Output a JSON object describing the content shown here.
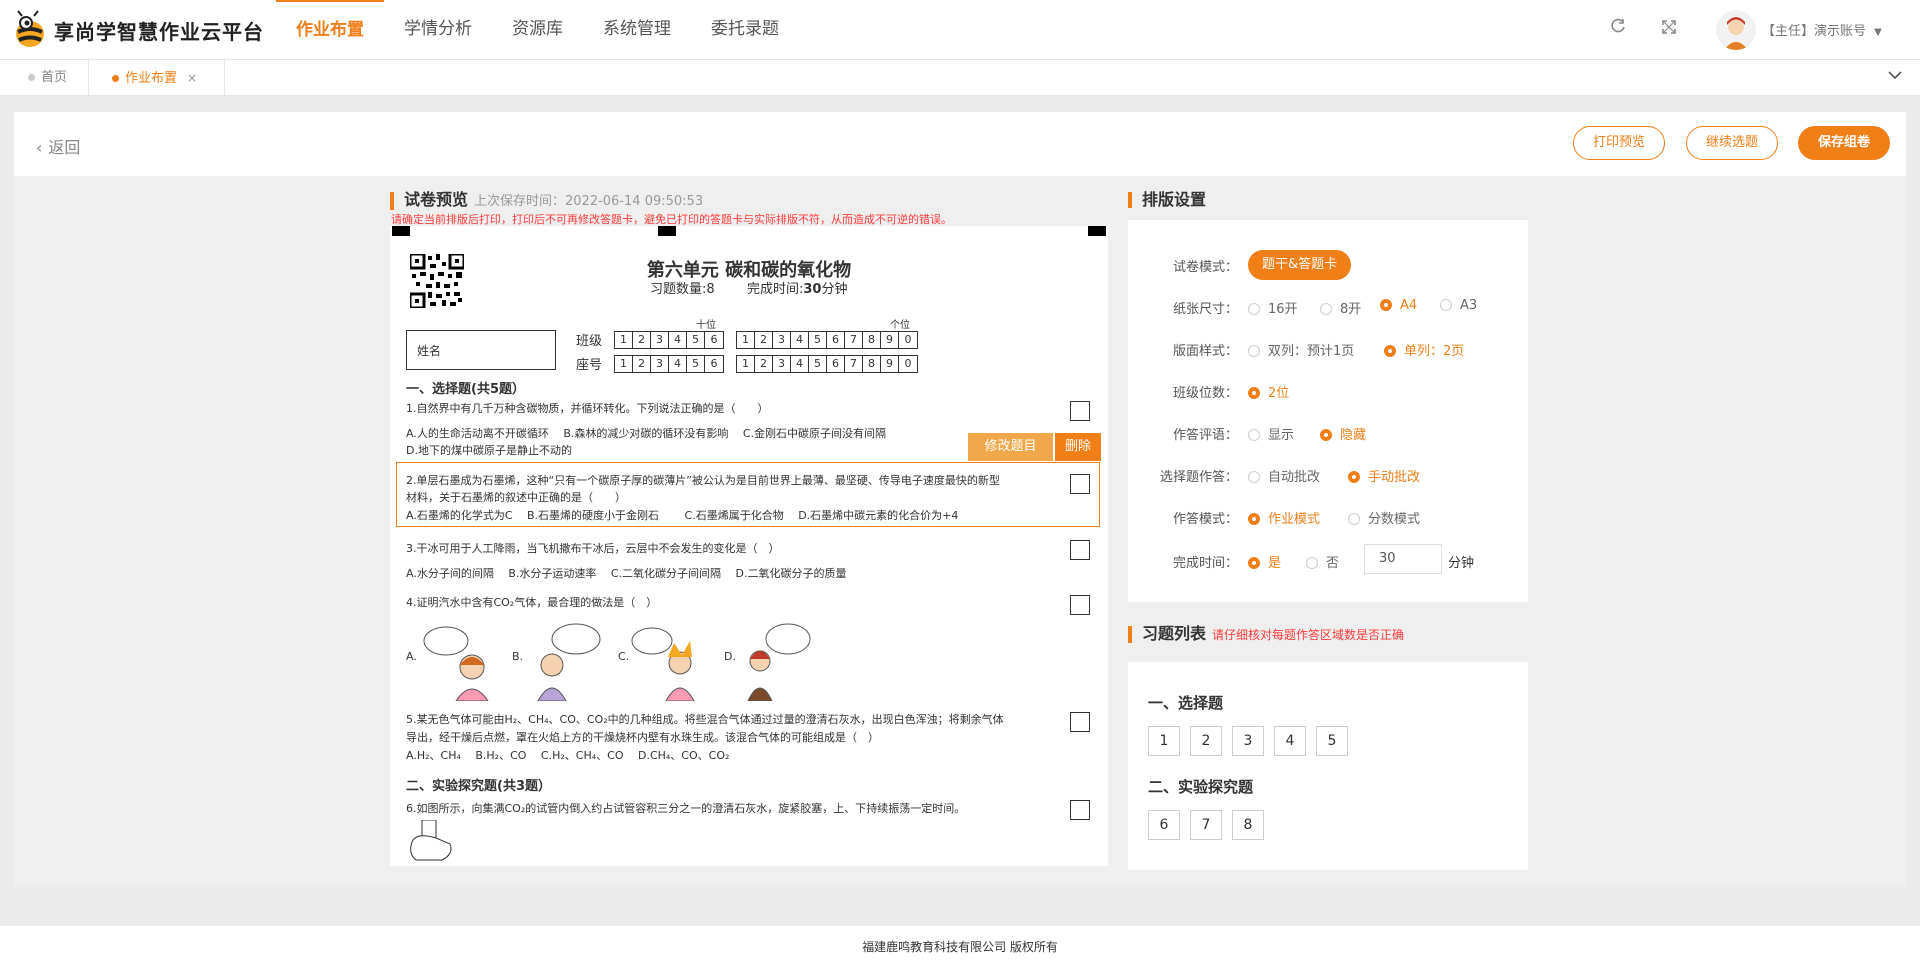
{
  "header": {
    "brand": "享尚学智慧作业云平台",
    "nav": [
      "作业布置",
      "学情分析",
      "资源库",
      "系统管理",
      "委托录题"
    ],
    "active_nav": 0,
    "user_label": "【主任】演示账号"
  },
  "tabs": [
    {
      "label": "首页",
      "active": false
    },
    {
      "label": "作业布置",
      "active": true,
      "close": "×"
    }
  ],
  "toolbar": {
    "back": "返回",
    "print_preview": "打印预览",
    "continue_select": "继续选题",
    "save": "保存组卷"
  },
  "preview": {
    "title": "试卷预览",
    "saved_time": "上次保存时间：2022-06-14 09:50:53",
    "warning": "请确定当前排版后打印，打印后不可再修改答题卡，避免已打印的答题卡与实际排版不符，从而造成不可逆的错误。"
  },
  "paper": {
    "unit_title": "第六单元 碳和碳的氧化物",
    "count_label": "习题数量:",
    "count_value": "8",
    "time_label": "完成时间:",
    "time_value": "30",
    "time_unit": "分钟",
    "name_label": "姓名",
    "class_label": "班级",
    "seat_label": "座号",
    "tens_label": "十位",
    "ones_label": "个位",
    "tens_digits": [
      "1",
      "2",
      "3",
      "4",
      "5",
      "6"
    ],
    "ones_digits": [
      "1",
      "2",
      "3",
      "4",
      "5",
      "6",
      "7",
      "8",
      "9",
      "0"
    ],
    "section1": "一、选择题(共5题）",
    "q1": "1.自然界中有几千万种含碳物质，并循环转化。下列说法正确的是（　　）",
    "q1_opts1": "A.人的生命活动离不开碳循环　 B.森林的减少对碳的循环没有影响　 C.金刚石中碳原子间没有间隔",
    "q1_opts2": "D.地下的煤中碳原子是静止不动的",
    "edit_btn": "修改题目",
    "delete_btn": "删除",
    "q2a": "2.单层石墨成为石墨烯，这种“只有一个碳原子厚的碳薄片”被公认为是目前世界上最薄、最坚硬、传导电子速度最快的新型",
    "q2b": "材料，关于石墨烯的叙述中正确的是（　　）",
    "q2_opts": "A.石墨烯的化学式为C　 B.石墨烯的硬度小于金刚石　　 C.石墨烯属于化合物　 D.石墨烯中碳元素的化合价为+4",
    "q3": "3.干冰可用于人工降雨，当飞机撒布干冰后，云层中不会发生的变化是（　）",
    "q3_opts": "A.水分子间的间隔　 B.水分子运动速率　 C.二氧化碳分子间间隔　 D.二氧化碳分子的质量",
    "q4": "4.证明汽水中含有CO₂气体，最合理的做法是（　）",
    "q4_labels": [
      "A.",
      "B.",
      "C.",
      "D."
    ],
    "q5a": "5.某无色气体可能由H₂、CH₄、CO、CO₂中的几种组成。将些混合气体通过过量的澄清石灰水，出现白色浑浊；将剩余气体",
    "q5b": "导出，经干燥后点燃，罩在火焰上方的干燥烧杯内壁有水珠生成。该混合气体的可能组成是（　）",
    "q5_opts": "A.H₂、CH₄　 B.H₂、CO　 C.H₂、CH₄、CO　 D.CH₄、CO、CO₂",
    "section2": "二、实验探究题(共3题）",
    "q6": "6.如图所示，向集满CO₂的试管内倒入约占试管容积三分之一的澄清石灰水，旋紧胶塞，上、下持续振荡一定时间。"
  },
  "settings": {
    "title": "排版设置",
    "rows": [
      {
        "label": "试卷模式：",
        "options": [
          "题干&答题卡"
        ],
        "selected": 0,
        "pill": true
      },
      {
        "label": "纸张尺寸：",
        "options": [
          "16开",
          "8开",
          "A4",
          "A3"
        ],
        "selected": 2
      },
      {
        "label": "版面样式：",
        "options": [
          "双列：预计1页",
          "单列：2页"
        ],
        "selected": 1
      },
      {
        "label": "班级位数：",
        "options": [
          "2位"
        ],
        "selected": 0
      },
      {
        "label": "作答评语：",
        "options": [
          "显示",
          "隐藏"
        ],
        "selected": 1
      },
      {
        "label": "选择题作答：",
        "options": [
          "自动批改",
          "手动批改"
        ],
        "selected": 1
      },
      {
        "label": "作答模式：",
        "options": [
          "作业模式",
          "分数模式"
        ],
        "selected": 0
      },
      {
        "label": "完成时间：",
        "options": [
          "是",
          "否"
        ],
        "selected": 0
      }
    ],
    "time_value": "30",
    "time_unit": "分钟"
  },
  "question_list": {
    "title": "习题列表",
    "hint": "请仔细核对每题作答区域数是否正确",
    "groups": [
      {
        "name": "一、选择题",
        "items": [
          "1",
          "2",
          "3",
          "4",
          "5"
        ]
      },
      {
        "name": "二、实验探究题",
        "items": [
          "6",
          "7",
          "8"
        ]
      }
    ]
  },
  "footer": "福建鹿鸣教育科技有限公司 版权所有",
  "colors": {
    "accent": "#f07f17",
    "warning": "#ff3b3b"
  }
}
